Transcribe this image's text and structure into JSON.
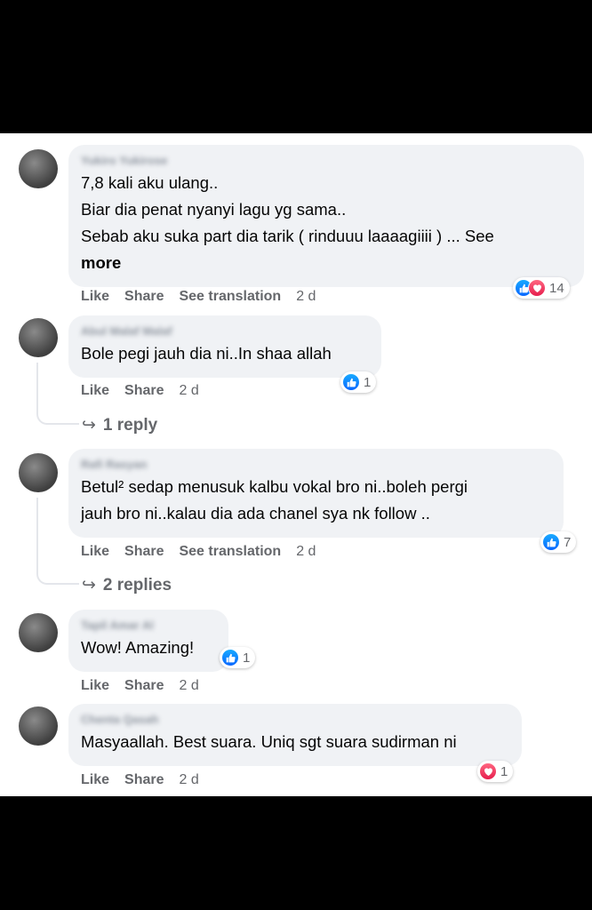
{
  "comments": [
    {
      "author": "Yukiro Yukirose",
      "lines": [
        "7,8 kali aku ulang..",
        "Biar dia penat nyanyi lagu yg sama..",
        "Sebab aku suka part dia tarik ( rinduuu laaaagiiii ) ... See"
      ],
      "see_more": "more",
      "actions": [
        "Like",
        "Share",
        "See translation"
      ],
      "time": "2 d",
      "reactions": [
        "like-icon",
        "love-icon"
      ],
      "reaction_count": "14"
    },
    {
      "author": "Abul Malaf Malaf",
      "lines": [
        "Bole pegi jauh dia ni..In shaa allah"
      ],
      "actions": [
        "Like",
        "Share"
      ],
      "time": "2 d",
      "reactions": [
        "like-icon"
      ],
      "reaction_count": "1",
      "replies": "1 reply"
    },
    {
      "author": "Rafi Rasyan",
      "lines": [
        "Betul² sedap menusuk kalbu vokal bro ni..boleh pergi",
        "jauh bro ni..kalau dia ada chanel sya nk follow .."
      ],
      "actions": [
        "Like",
        "Share",
        "See translation"
      ],
      "time": "2 d",
      "reactions": [
        "like-icon"
      ],
      "reaction_count": "7",
      "replies": "2 replies"
    },
    {
      "author": "Tapil Amar Al",
      "lines": [
        "Wow! Amazing!"
      ],
      "actions": [
        "Like",
        "Share"
      ],
      "time": "2 d",
      "reactions": [
        "like-icon"
      ],
      "reaction_count": "1"
    },
    {
      "author": "Chenta Qasah",
      "lines": [
        "Masyaallah. Best suara. Uniq sgt suara sudirman ni"
      ],
      "actions": [
        "Like",
        "Share"
      ],
      "time": "2 d",
      "reactions": [
        "love-icon"
      ],
      "reaction_count": "1"
    }
  ],
  "colors": {
    "bubble": "#f0f2f5",
    "meta": "#65676b",
    "like": "#0866ff",
    "love": "#e61e4d"
  }
}
